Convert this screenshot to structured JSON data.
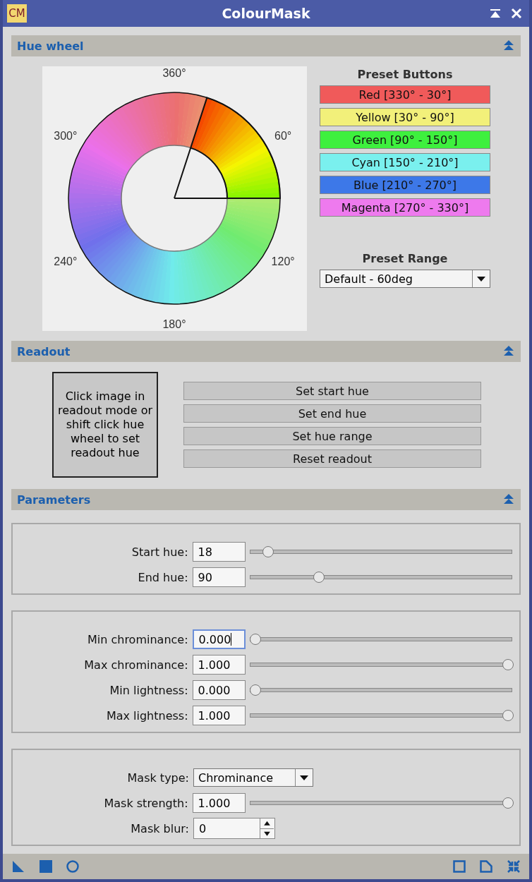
{
  "window": {
    "title": "ColourMask",
    "logo": "CM"
  },
  "hue_wheel": {
    "title": "Hue wheel",
    "expanded": true,
    "wheel_labels": [
      "360°",
      "60°",
      "120°",
      "180°",
      "240°",
      "300°"
    ],
    "preset_title": "Preset Buttons",
    "presets": [
      {
        "label": "Red [330° - 30°]",
        "color": "#f05a5a"
      },
      {
        "label": "Yellow [30° - 90°]",
        "color": "#f2f07a"
      },
      {
        "label": "Green [90° - 150°]",
        "color": "#3ef03e"
      },
      {
        "label": "Cyan [150° - 210°]",
        "color": "#7af0ee"
      },
      {
        "label": "Blue [210° - 270°]",
        "color": "#3d78e8"
      },
      {
        "label": "Magenta [270° - 330°]",
        "color": "#ee7aee"
      }
    ],
    "range_title": "Preset Range",
    "range_value": "Default - 60deg"
  },
  "readout": {
    "title": "Readout",
    "expanded": true,
    "info": "Click image in readout mode or shift click hue wheel to set readout hue",
    "buttons": [
      "Set start hue",
      "Set end hue",
      "Set hue range",
      "Reset readout"
    ]
  },
  "parameters": {
    "title": "Parameters",
    "expanded": true,
    "groups": [
      [
        {
          "kind": "slider",
          "label": "Start hue:",
          "value": "18",
          "level": 0.05,
          "focused": false
        },
        {
          "kind": "slider",
          "label": "End hue:",
          "value": "90",
          "level": 0.25,
          "focused": false
        }
      ],
      [
        {
          "kind": "slider",
          "label": "Min chrominance:",
          "value": "0.000",
          "level": 0,
          "focused": true
        },
        {
          "kind": "slider",
          "label": "Max chrominance:",
          "value": "1.000",
          "level": 1,
          "focused": false
        },
        {
          "kind": "slider",
          "label": "Min lightness:",
          "value": "0.000",
          "level": 0,
          "focused": false
        },
        {
          "kind": "slider",
          "label": "Max lightness:",
          "value": "1.000",
          "level": 1,
          "focused": false
        }
      ],
      [
        {
          "kind": "dropdown",
          "label": "Mask type:",
          "value": "Chrominance"
        },
        {
          "kind": "slider",
          "label": "Mask strength:",
          "value": "1.000",
          "level": 1,
          "focused": false
        },
        {
          "kind": "spin",
          "label": "Mask blur:",
          "value": "0"
        }
      ]
    ]
  }
}
